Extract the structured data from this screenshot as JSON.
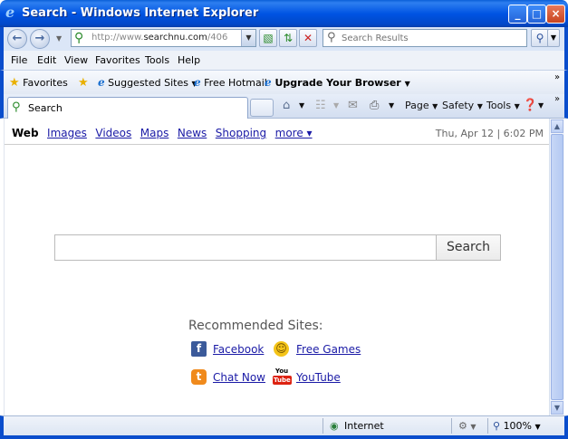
{
  "window": {
    "title": "Search - Windows Internet Explorer",
    "minimize": "_",
    "maximize": "□",
    "close": "×"
  },
  "address": {
    "url_prefix": "http://www.",
    "url_domain": "searchnu.com",
    "url_path": "/406",
    "search_placeholder": "Search Results"
  },
  "menu": [
    "File",
    "Edit",
    "View",
    "Favorites",
    "Tools",
    "Help"
  ],
  "favorites_bar": {
    "favorites": "Favorites",
    "suggested": "Suggested Sites",
    "hotmail": "Free Hotmail",
    "upgrade": "Upgrade Your Browser"
  },
  "tab": {
    "label": "Search"
  },
  "commands": {
    "page": "Page",
    "safety": "Safety",
    "tools": "Tools"
  },
  "page": {
    "nav": {
      "web": "Web",
      "links": [
        "Images",
        "Videos",
        "Maps",
        "News",
        "Shopping"
      ],
      "more": "more ▾"
    },
    "datetime": "Thu, Apr 12 | 6:02 PM",
    "search_button": "Search",
    "search_value": "",
    "recommended_title": "Recommended Sites:",
    "sites": [
      {
        "label": "Facebook",
        "icon": "facebook-icon"
      },
      {
        "label": "Free Games",
        "icon": "smiley-icon"
      },
      {
        "label": "Chat Now",
        "icon": "chat-icon"
      },
      {
        "label": "YouTube",
        "icon": "youtube-icon"
      }
    ]
  },
  "status": {
    "zone": "Internet",
    "zoom": "100%"
  }
}
